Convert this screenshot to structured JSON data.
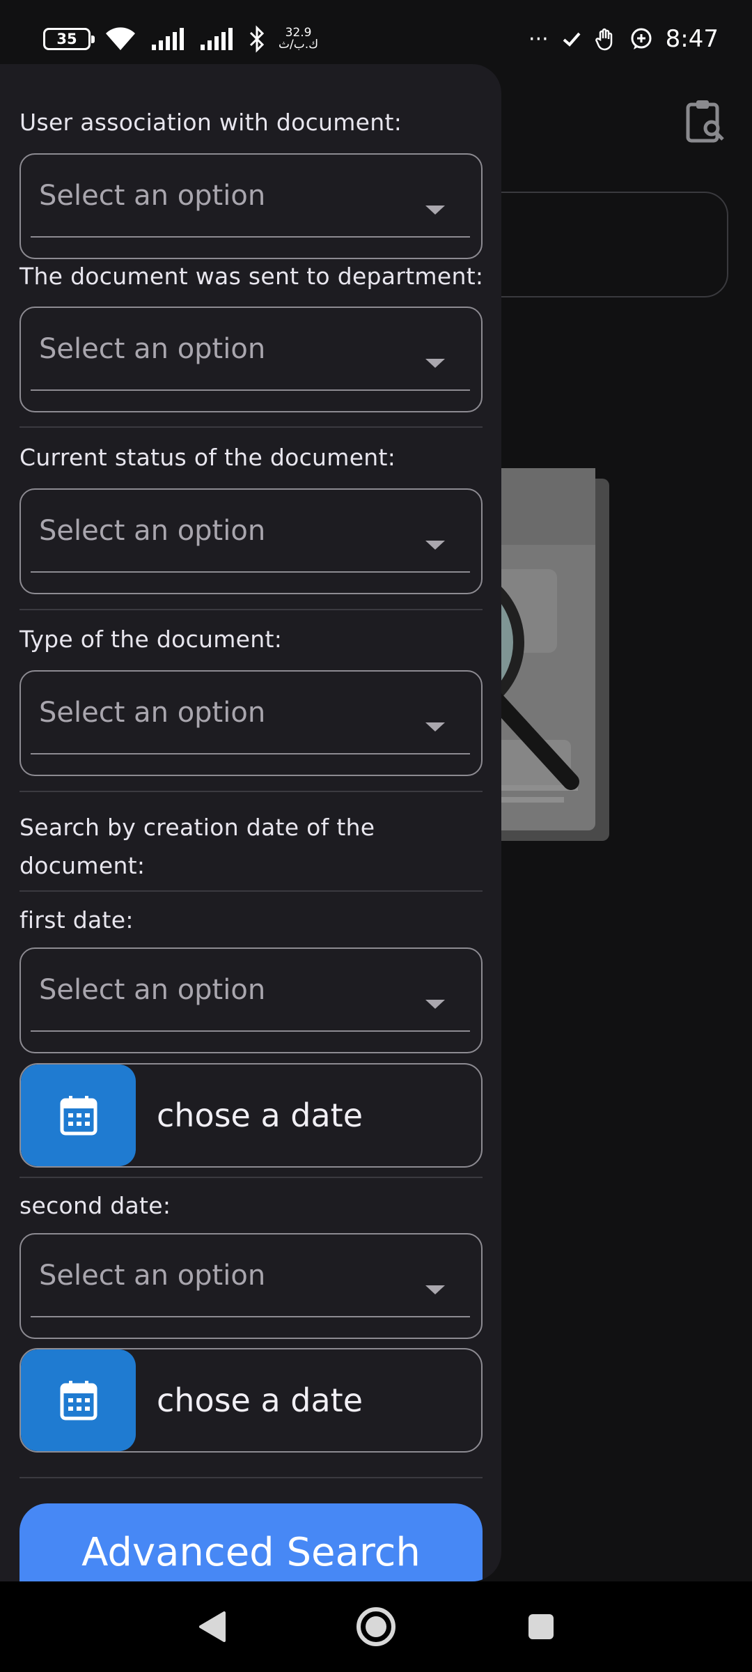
{
  "status_bar": {
    "battery": "35",
    "speed_value": "32.9",
    "speed_unit": "ك.ب/ث",
    "overflow": "···",
    "time": "8:47"
  },
  "drawer": {
    "user_association": {
      "label": "User association with document:",
      "placeholder": "Select an option"
    },
    "department": {
      "label": "The document was sent to department:",
      "placeholder": "Select an option"
    },
    "status": {
      "label": "Current status of the document:",
      "placeholder": "Select an option"
    },
    "type": {
      "label": "Type of the document:",
      "placeholder": "Select an option"
    },
    "creation_date_heading": "Search by creation date of the document:",
    "first_date": {
      "label": "first date:",
      "placeholder": "Select an option",
      "button": "chose a date"
    },
    "second_date": {
      "label": "second date:",
      "placeholder": "Select an option",
      "button": "chose a date"
    },
    "advanced_search": "Advanced Search"
  },
  "colors": {
    "drawer_bg": "#1d1c21",
    "accent_blue": "#1f7bd1",
    "button_blue": "#4788f5"
  },
  "icons": [
    "wifi-icon",
    "signal-icon",
    "bluetooth-icon",
    "check-icon",
    "hand-icon",
    "chat-plus-icon",
    "clipboard-search-icon",
    "calendar-icon",
    "back-icon",
    "home-icon",
    "recents-icon"
  ]
}
